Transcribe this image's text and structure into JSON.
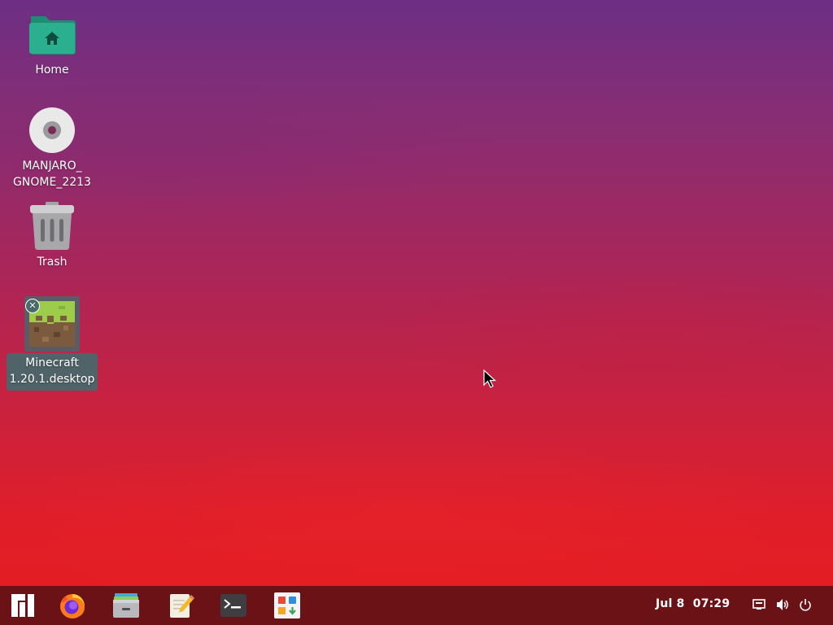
{
  "desktop": {
    "icons": [
      {
        "label": "Home",
        "icon": "home-folder-icon"
      },
      {
        "label": "MANJARO_\nGNOME_2213",
        "label_line1": "MANJARO_",
        "label_line2": "GNOME_2213",
        "icon": "optical-disc-icon"
      },
      {
        "label": "Trash",
        "icon": "trash-icon"
      },
      {
        "label_line1": "Minecraft",
        "label_line2": "1.20.1.desktop",
        "icon": "minecraft-grass-block-icon",
        "badge": "✕"
      }
    ]
  },
  "taskbar": {
    "apps": [
      {
        "name": "Application Menu",
        "icon": "manjaro-logo-icon"
      },
      {
        "name": "Firefox",
        "icon": "firefox-icon"
      },
      {
        "name": "Files",
        "icon": "file-manager-icon"
      },
      {
        "name": "Text Editor",
        "icon": "text-editor-icon"
      },
      {
        "name": "Terminal",
        "icon": "terminal-icon"
      },
      {
        "name": "Software",
        "icon": "software-center-icon"
      }
    ],
    "clock": {
      "date": "Jul 8",
      "time": "07:29"
    },
    "tray": [
      "network-icon",
      "volume-icon",
      "power-icon"
    ]
  },
  "colors": {
    "taskbar": "#6b1216",
    "selection": "#3c6e6e"
  }
}
